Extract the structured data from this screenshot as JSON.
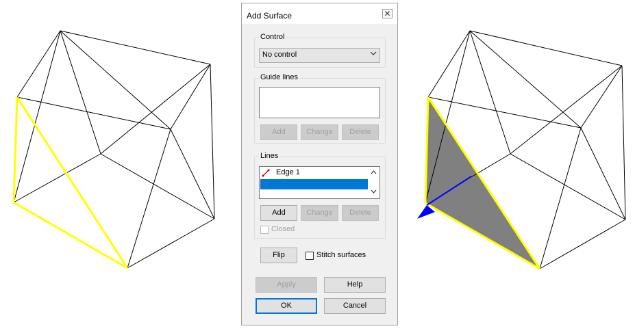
{
  "dialog": {
    "title": "Add Surface",
    "close_glyph": "✕",
    "control": {
      "label": "Control",
      "selected": "No control"
    },
    "guide_lines": {
      "label": "Guide lines",
      "add": "Add",
      "change": "Change",
      "delete": "Delete"
    },
    "lines": {
      "label": "Lines",
      "items": [
        "Edge 1"
      ],
      "add": "Add",
      "change": "Change",
      "delete": "Delete",
      "closed_label": "Closed",
      "closed_checked": false
    },
    "flip": "Flip",
    "stitch_label": "Stitch surfaces",
    "stitch_checked": false,
    "apply": "Apply",
    "help": "Help",
    "ok": "OK",
    "cancel": "Cancel"
  },
  "colors": {
    "highlight_edge": "#ffff00",
    "surface_fill": "#808080",
    "normal_arrow": "#0000ff",
    "selection": "#0078d7"
  }
}
